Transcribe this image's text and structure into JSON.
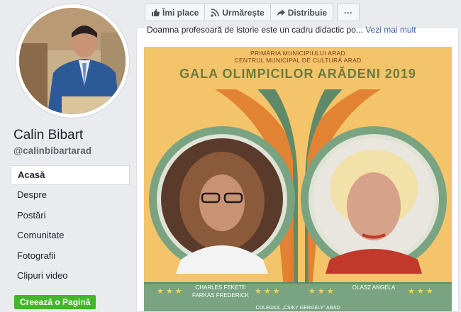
{
  "sidebar": {
    "page_name": "Calin Bibart",
    "handle": "@calinbibartarad",
    "nav": [
      {
        "label": "Acasă",
        "active": true
      },
      {
        "label": "Despre",
        "active": false
      },
      {
        "label": "Postări",
        "active": false
      },
      {
        "label": "Comunitate",
        "active": false
      },
      {
        "label": "Fotografii",
        "active": false
      },
      {
        "label": "Clipuri video",
        "active": false
      }
    ],
    "create_page_label": "Creează o Pagină"
  },
  "actions": {
    "like": "Îmi place",
    "follow": "Urmărește",
    "share": "Distribuie",
    "more": "···"
  },
  "post": {
    "text": "Doamna profesoară de istorie este un cadru didactic po...",
    "see_more": "Vezi mai mult"
  },
  "poster": {
    "line1": "PRIMĂRIA MUNICIPIULUI ARAD",
    "line2": "CENTRUL MUNICIPAL DE CULTURĂ ARAD",
    "title": "GALA OLIMPICILOR ARĂDENI 2019",
    "left_name_1": "CHARLES FEKETE",
    "left_name_2": "FARKAS FREDERICK",
    "right_name": "OLASZ ANGELA",
    "school": "COLEGIUL „CSIKY GERGELY” ARAD",
    "stars": "★★★"
  },
  "colors": {
    "accent_green": "#42b72a",
    "poster_bg": "#f4c46a",
    "poster_green": "#7aa381",
    "link_blue": "#385898"
  }
}
